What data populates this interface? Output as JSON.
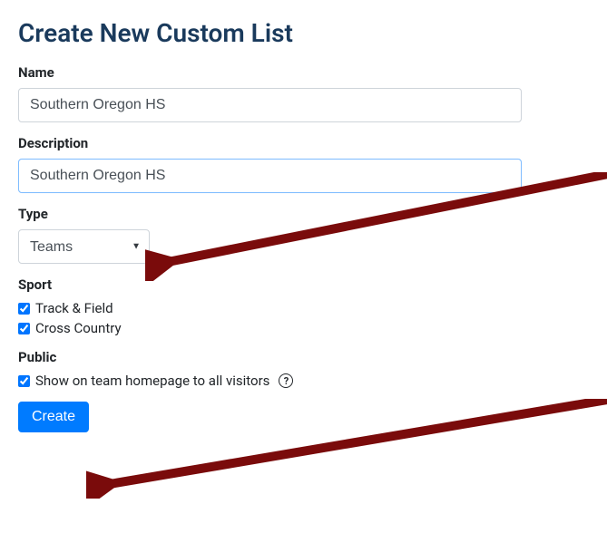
{
  "title": "Create New Custom List",
  "name": {
    "label": "Name",
    "value": "Southern Oregon HS"
  },
  "description": {
    "label": "Description",
    "value": "Southern Oregon HS"
  },
  "type": {
    "label": "Type",
    "selected": "Teams"
  },
  "sport": {
    "label": "Sport",
    "options": [
      {
        "label": "Track & Field",
        "checked": true
      },
      {
        "label": "Cross Country",
        "checked": true
      }
    ]
  },
  "public": {
    "label": "Public",
    "option_label": "Show on team homepage to all visitors",
    "checked": true
  },
  "create_button": "Create",
  "help_icon_glyph": "?"
}
